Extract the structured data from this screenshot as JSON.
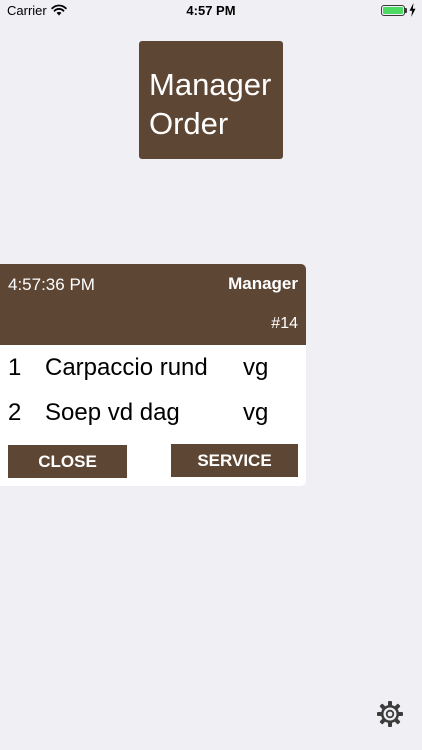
{
  "status_bar": {
    "carrier": "Carrier",
    "time": "4:57 PM",
    "battery_level": 1.0,
    "wifi_icon": "wifi-icon",
    "charging_icon": "charging-bolt-icon"
  },
  "title": {
    "line1": "Manager",
    "line2": "Order"
  },
  "order": {
    "time": "4:57:36 PM",
    "role": "Manager",
    "number": "#14",
    "items": [
      {
        "qty": "1",
        "name": "Carpaccio rund",
        "unit": "vg"
      },
      {
        "qty": "2",
        "name": "Soep vd dag",
        "unit": "vg"
      }
    ],
    "close_label": "CLOSE",
    "service_label": "SERVICE"
  },
  "settings_icon": "gear-icon",
  "colors": {
    "brand_brown": "#5e4634",
    "background": "#efeff4",
    "battery_green": "#4cd964"
  }
}
